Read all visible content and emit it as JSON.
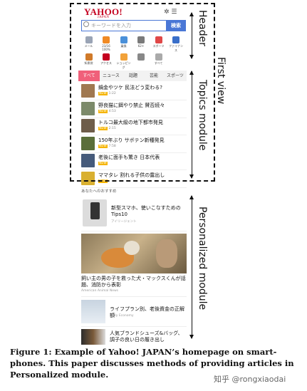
{
  "header": {
    "logo": "YAHOO!",
    "logo_sub": "JAPAN",
    "search_placeholder": "キーワードを入力",
    "search_button": "検索",
    "icons": [
      {
        "label": "メール",
        "color": "#9aa4b5"
      },
      {
        "label": "23/16 100%",
        "color": "#f08a24"
      },
      {
        "label": "乗換",
        "color": "#4a90d9"
      },
      {
        "label": "62+",
        "color": "#7a7a7a"
      },
      {
        "label": "スポーツ",
        "color": "#e04848"
      },
      {
        "label": "ファイナンス",
        "color": "#3a6fc9"
      },
      {
        "label": "知恵袋",
        "color": "#d07a2a"
      },
      {
        "label": "アクセス",
        "color": "#c4001f"
      },
      {
        "label": "ショッピング",
        "color": "#f2a23a"
      },
      {
        "label": "",
        "color": "#888"
      },
      {
        "label": "すべて",
        "color": "#aaa"
      }
    ]
  },
  "tabs": [
    "すべて",
    "ニュース",
    "話題",
    "芸能",
    "スポーツ"
  ],
  "topics": [
    {
      "title": "鍋金やツケ 民法どう変わる?",
      "meta": "1:22",
      "color": "#a07850"
    },
    {
      "title": "野良猫に餌やり禁止 賛否続々",
      "meta": "4:53",
      "color": "#7c8a6a"
    },
    {
      "title": "トルコ最大級の地下都市発見",
      "meta": "2:15",
      "color": "#6e5d4a"
    },
    {
      "title": "150年ぶり サボテン新種発見",
      "meta": "7:58",
      "color": "#5a6e3a"
    },
    {
      "title": "老後に面手も驚き 日本代表",
      "meta": "",
      "color": "#455a7a"
    },
    {
      "title": "ママタレ 割れる子供の露出し",
      "meta": "",
      "color": "#d9b030"
    }
  ],
  "personalized": {
    "heading": "あなたへのおすすめ",
    "articles": [
      {
        "title": "新型スマホ、使いこなすための Tips10",
        "source": "アイリージェント"
      },
      {
        "title": "飼い主の男の子を救った犬・マックスくんが話題、消防から表彰",
        "source": "American Animal News"
      },
      {
        "title": "ライフプラン別、老後資金の正解額",
        "source": "Daily Economy"
      },
      {
        "title": "人気ブランドシューズ&バッグ、調子の良い日の履き出し",
        "source": ""
      }
    ]
  },
  "annotations": {
    "first_view": "First view",
    "header": "Header",
    "topics_module": "Topics module",
    "personalized_module": "Personalized module"
  },
  "caption": "Figure 1: Example of Yahoo! JAPAN’s homepage on smart-phones. This paper discusses methods of providing articles in Personalized module.",
  "watermark": "知乎 @rongxiaodai"
}
